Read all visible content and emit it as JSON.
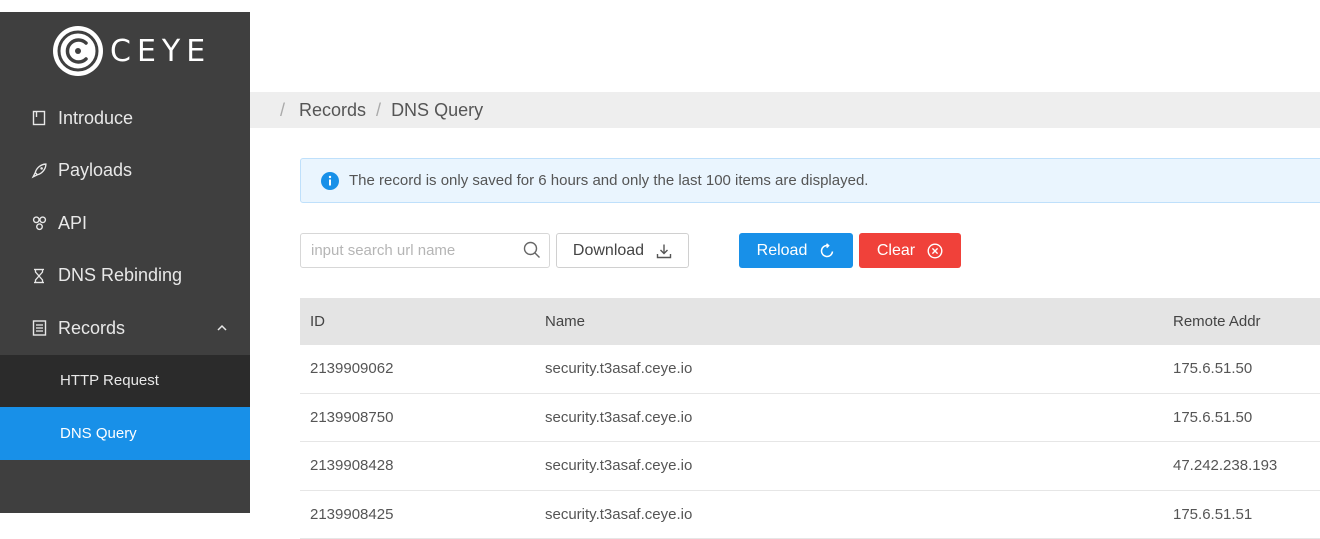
{
  "brand": {
    "name": "CEYE"
  },
  "sidebar": {
    "items": [
      {
        "label": "Introduce",
        "icon": "book-icon"
      },
      {
        "label": "Payloads",
        "icon": "rocket-icon"
      },
      {
        "label": "API",
        "icon": "api-icon"
      },
      {
        "label": "DNS Rebinding",
        "icon": "hourglass-icon"
      },
      {
        "label": "Records",
        "icon": "records-icon",
        "expanded": true
      }
    ],
    "sub_items": [
      {
        "label": "HTTP Request",
        "active": false
      },
      {
        "label": "DNS Query",
        "active": true
      }
    ]
  },
  "breadcrumb": {
    "sep": "/",
    "parent": "Records",
    "current": "DNS Query"
  },
  "alert": {
    "text": "The record is only saved for 6 hours and only the last 100 items are displayed.",
    "icon": "info-icon"
  },
  "toolbar": {
    "search_placeholder": "input search url name",
    "download_label": "Download",
    "reload_label": "Reload",
    "clear_label": "Clear"
  },
  "table": {
    "headers": {
      "id": "ID",
      "name": "Name",
      "remote_addr": "Remote Addr"
    },
    "rows": [
      {
        "id": "2139909062",
        "name": "security.t3asaf.ceye.io",
        "remote_addr": "175.6.51.50"
      },
      {
        "id": "2139908750",
        "name": "security.t3asaf.ceye.io",
        "remote_addr": "175.6.51.50"
      },
      {
        "id": "2139908428",
        "name": "security.t3asaf.ceye.io",
        "remote_addr": "47.242.238.193"
      },
      {
        "id": "2139908425",
        "name": "security.t3asaf.ceye.io",
        "remote_addr": "175.6.51.51"
      }
    ]
  },
  "colors": {
    "sidebar_bg": "#3f3f3f",
    "submenu_bg": "#2b2b2b",
    "accent": "#1890e8",
    "danger": "#f0413a",
    "alert_bg": "#eaf5fe"
  }
}
